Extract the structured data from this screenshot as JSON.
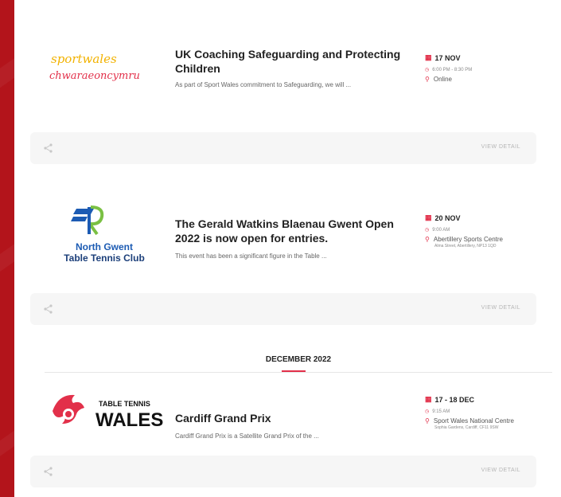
{
  "events": [
    {
      "logo_lines": [
        "sportwales",
        "chwaraeoncymru"
      ],
      "title": "UK Coaching Safeguarding and Protecting Children",
      "description": "As part of Sport Wales commitment to Safeguarding, we will ...",
      "date": "17 NOV",
      "time": "6:00 PM - 8:30 PM",
      "location": "Online",
      "address": "",
      "view_label": "VIEW DETAIL",
      "calendar_icon": "calendar-icon",
      "clock_icon": "clock-icon",
      "pin_icon": "map-pin-icon",
      "share_icon": "share-icon"
    },
    {
      "logo_lines": [
        "North Gwent",
        "Table Tennis Club"
      ],
      "title": "The Gerald Watkins Blaenau Gwent Open 2022 is now open for entries.",
      "description": "This event has been a significant figure in the Table ...",
      "date": "20 NOV",
      "time": "9:00 AM",
      "location": "Abertillery Sports Centre",
      "address": "Alma Street, Abertillery, NP13 1QD",
      "view_label": "VIEW DETAIL",
      "calendar_icon": "calendar-icon",
      "clock_icon": "clock-icon",
      "pin_icon": "map-pin-icon",
      "share_icon": "share-icon"
    },
    {
      "logo_lines": [
        "TABLE TENNIS",
        "WALES"
      ],
      "title": "Cardiff Grand Prix",
      "description": "Cardiff Grand Prix is a Satellite Grand Prix of the ...",
      "date": "17 - 18 DEC",
      "time": "9:15 AM",
      "location": "Sport Wales National Centre",
      "address": "Sophia Gardens, Cardiff, CF11 9SW",
      "view_label": "VIEW DETAIL",
      "calendar_icon": "calendar-icon",
      "clock_icon": "clock-icon",
      "pin_icon": "map-pin-icon",
      "share_icon": "share-icon"
    }
  ],
  "month_heading": "DECEMBER 2022",
  "colors": {
    "accent": "#e2304a",
    "background": "#b3141b",
    "panel": "#ffffff"
  }
}
